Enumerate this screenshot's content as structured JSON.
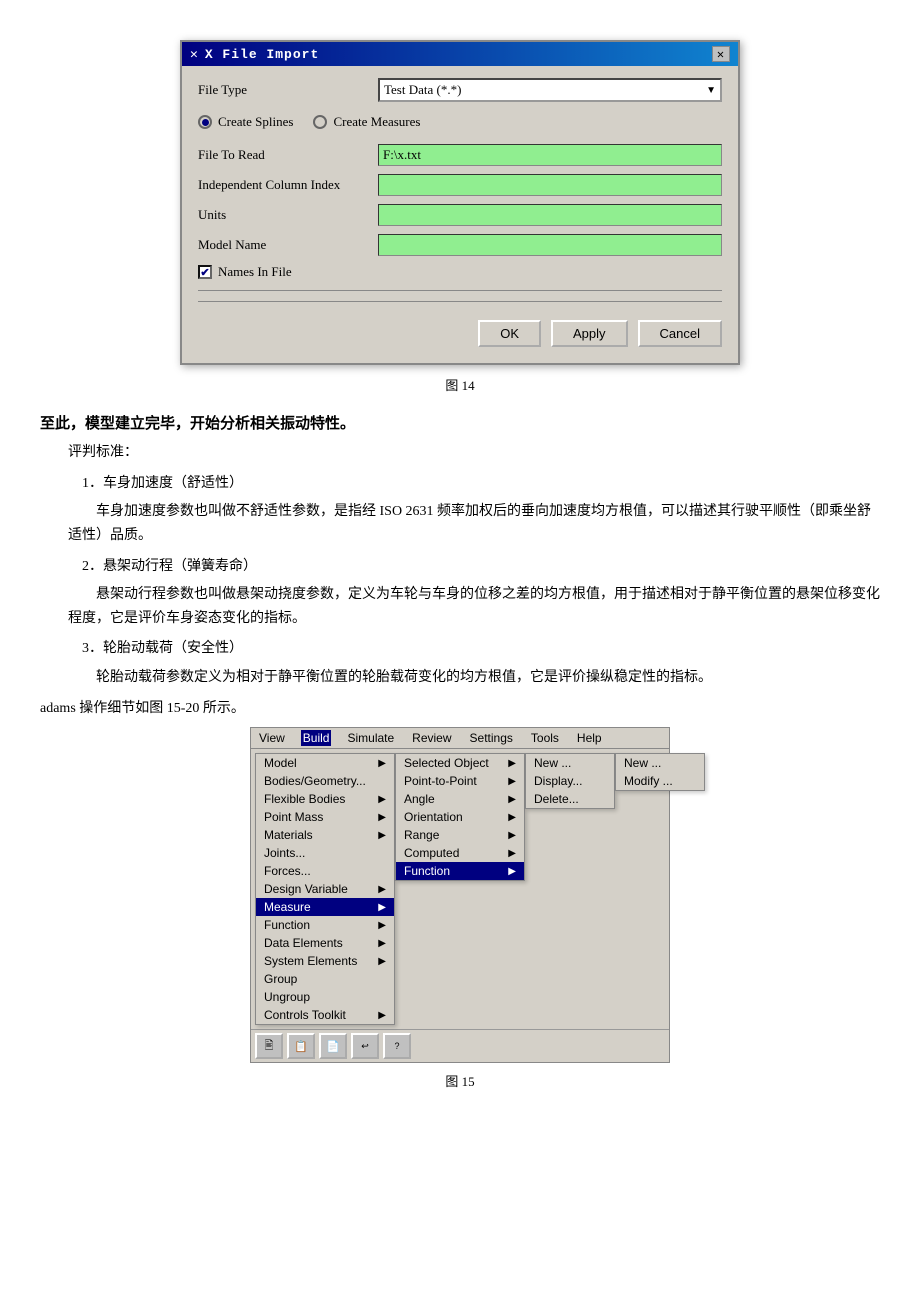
{
  "dialog": {
    "title": "X File Import",
    "close_btn": "✕",
    "filetype_label": "File Type",
    "filetype_value": "Test Data (*.*)",
    "radio_option1": "Create Splines",
    "radio_option2": "Create Measures",
    "file_label": "File To Read",
    "file_value": "F:\\x.txt",
    "col_index_label": "Independent Column Index",
    "col_index_value": "",
    "units_label": "Units",
    "units_value": "",
    "model_name_label": "Model Name",
    "model_name_value": "",
    "checkbox_label": "Names In File",
    "btn_ok": "OK",
    "btn_apply": "Apply",
    "btn_cancel": "Cancel"
  },
  "fig14_label": "图 14",
  "section_title": "至此，模型建立完毕，开始分析相关振动特性。",
  "para_criteria": "评判标准：",
  "criteria": [
    {
      "number": "1．车身加速度（舒适性）",
      "body": "车身加速度参数也叫做不舒适性参数，是指经 ISO 2631 频率加权后的垂向加速度均方根值，可以描述其行驶平顺性（即乘坐舒适性）品质。"
    },
    {
      "number": "2．悬架动行程（弹簧寿命）",
      "body": "悬架动行程参数也叫做悬架动挠度参数，定义为车轮与车身的位移之差的均方根值，用于描述相对于静平衡位置的悬架位移变化程度，它是评价车身姿态变化的指标。"
    },
    {
      "number": "3．轮胎动载荷（安全性）",
      "body": "轮胎动载荷参数定义为相对于静平衡位置的轮胎载荷变化的均方根值，它是评价操纵稳定性的指标。"
    }
  ],
  "adams_note": "adams 操作细节如图 15-20 所示。",
  "fig15_label": "图 15",
  "menu": {
    "topbar": [
      "View",
      "Build",
      "Simulate",
      "Review",
      "Settings",
      "Tools",
      "Help"
    ],
    "items": [
      {
        "label": "Model",
        "has_sub": true
      },
      {
        "label": "Bodies/Geometry...",
        "has_sub": false
      },
      {
        "label": "Flexible Bodies",
        "has_sub": true
      },
      {
        "label": "Point Mass",
        "has_sub": true
      },
      {
        "label": "Materials",
        "has_sub": true
      },
      {
        "label": "Joints...",
        "has_sub": false
      },
      {
        "label": "Forces...",
        "has_sub": false
      },
      {
        "label": "Design Variable",
        "has_sub": true
      },
      {
        "label": "Measure",
        "highlighted": true,
        "has_sub": true
      },
      {
        "label": "Function",
        "has_sub": true
      },
      {
        "label": "Data Elements",
        "has_sub": true
      },
      {
        "label": "System Elements",
        "has_sub": true
      },
      {
        "label": "Group",
        "has_sub": false
      },
      {
        "label": "Ungroup",
        "has_sub": false
      },
      {
        "label": "Controls Toolkit",
        "has_sub": true
      }
    ],
    "sub1_items": [
      {
        "label": "Selected Object",
        "has_sub": true
      },
      {
        "label": "Point-to-Point",
        "has_sub": true
      },
      {
        "label": "Angle",
        "has_sub": true
      },
      {
        "label": "Orientation",
        "has_sub": true
      },
      {
        "label": "Range",
        "has_sub": true
      },
      {
        "label": "Computed",
        "has_sub": true
      },
      {
        "label": "Function",
        "highlighted": true,
        "has_sub": true
      }
    ],
    "sub2_items": [
      {
        "label": "New ..."
      },
      {
        "label": "Display..."
      },
      {
        "label": "Delete..."
      }
    ],
    "sub3_items": [
      {
        "label": "New ..."
      },
      {
        "label": "Modify ..."
      }
    ]
  }
}
